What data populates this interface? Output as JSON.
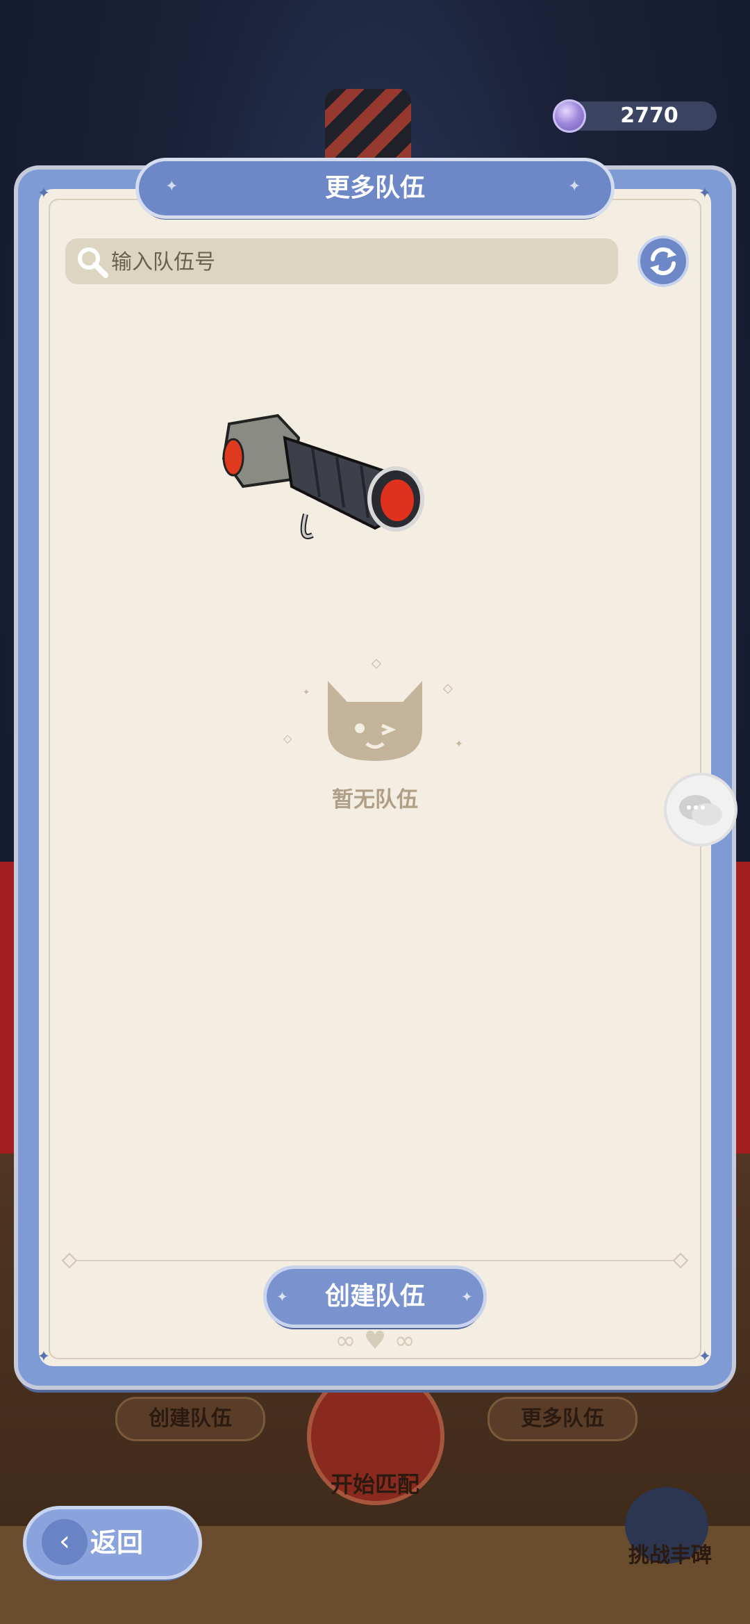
{
  "currency": {
    "value": "2770",
    "icon": "gem-icon"
  },
  "panel": {
    "title": "更多队伍"
  },
  "search": {
    "placeholder": "输入队伍号",
    "value": ""
  },
  "empty_state": {
    "text": "暂无队伍"
  },
  "actions": {
    "create_team": "创建队伍"
  },
  "background": {
    "create_team": "创建队伍",
    "more_teams": "更多队伍",
    "start_match": "开始匹配",
    "challenge_trophy": "挑战丰碑"
  },
  "navigation": {
    "back": "返回"
  },
  "colors": {
    "panel_border": "#7f9bd6",
    "panel_bg": "#f3ede2",
    "accent": "#6e88c7",
    "empty_text": "#b09f87"
  }
}
